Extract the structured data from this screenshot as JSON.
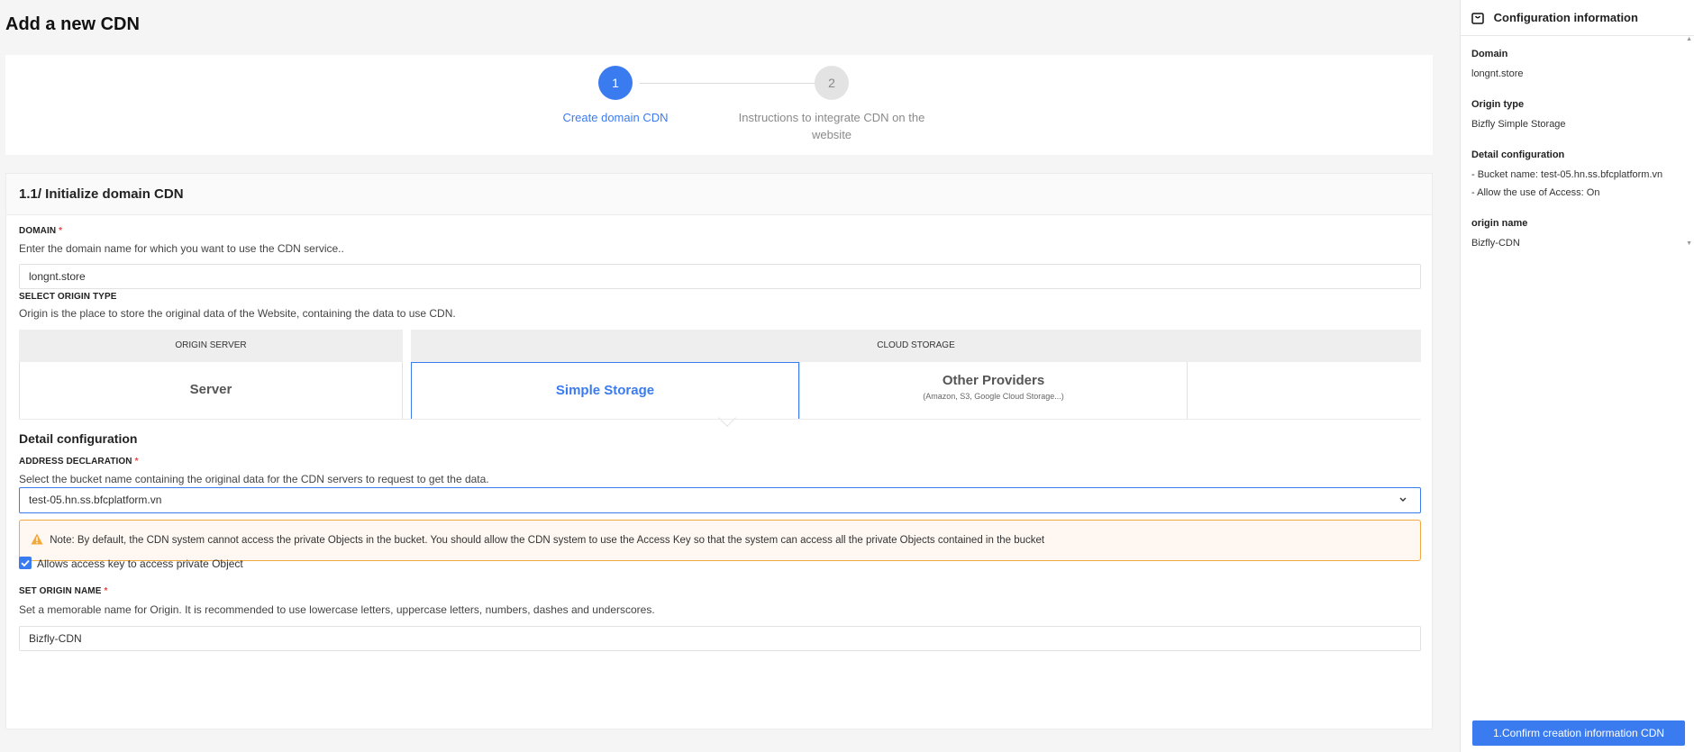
{
  "page": {
    "title": "Add a new CDN"
  },
  "stepper": {
    "steps": [
      {
        "number": "1",
        "label": "Create domain CDN"
      },
      {
        "number": "2",
        "label": "Instructions to integrate CDN on the website"
      }
    ]
  },
  "form": {
    "section_title": "1.1/ Initialize domain CDN",
    "domain": {
      "label": "DOMAIN",
      "required_mark": "*",
      "description": "Enter the domain name for which you want to use the CDN service..",
      "value": "longnt.store"
    },
    "origin_type": {
      "label": "SELECT ORIGIN TYPE",
      "description": "Origin is the place to store the original data of the Website, containing the data to use CDN.",
      "group_origin_server": "ORIGIN SERVER",
      "group_cloud_storage": "CLOUD STORAGE",
      "option_server": "Server",
      "option_simple_storage": "Simple Storage",
      "option_other_providers": "Other Providers",
      "option_other_providers_sub": "(Amazon, S3, Google Cloud Storage...)",
      "selected": "Simple Storage"
    },
    "detail_config": {
      "title": "Detail configuration",
      "address_label": "ADDRESS DECLARATION",
      "required_mark": "*",
      "address_description": "Select the bucket name containing the original data for the CDN servers to request to get the data.",
      "bucket_value": "test-05.hn.ss.bfcplatform.vn",
      "note": "Note: By default, the CDN system cannot access the private Objects in the bucket. You should allow the CDN system to use the Access Key so that the system can access all the private Objects contained in the bucket",
      "checkbox_label": "Allows access key to access private Object",
      "checkbox_checked": true
    },
    "origin_name": {
      "label": "SET ORIGIN NAME",
      "required_mark": "*",
      "description": "Set a memorable name for Origin. It is recommended to use lowercase letters, uppercase letters, numbers, dashes and underscores.",
      "value": "Bizfly-CDN"
    }
  },
  "sidebar": {
    "title": "Configuration information",
    "items": [
      {
        "label": "Domain",
        "values": [
          "longnt.store"
        ]
      },
      {
        "label": "Origin type",
        "values": [
          "Bizfly Simple Storage"
        ]
      },
      {
        "label": "Detail configuration",
        "values": [
          "- Bucket name: test-05.hn.ss.bfcplatform.vn",
          "- Allow the use of Access: On"
        ]
      },
      {
        "label": "origin name",
        "values": [
          "Bizfly-CDN"
        ]
      }
    ],
    "confirm_button": "1.Confirm creation information CDN"
  },
  "colors": {
    "accent": "#3b7bf0",
    "warning": "#f0a93d",
    "required": "#e64545"
  },
  "icons": {
    "sidebar_header": "shopping-bag-icon",
    "note": "warning-triangle-icon",
    "select": "chevron-down-icon",
    "checkbox": "check-icon"
  }
}
